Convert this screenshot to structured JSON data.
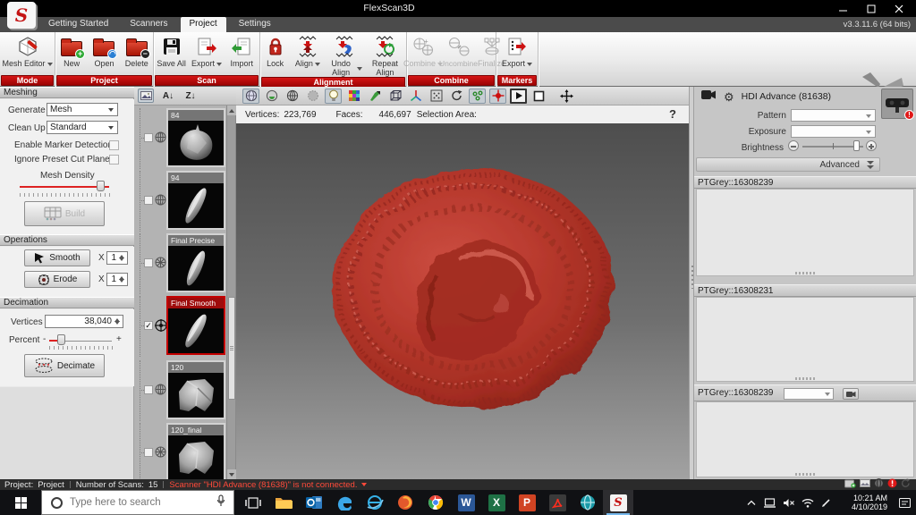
{
  "window": {
    "title": "FlexScan3D",
    "version": "v3.3.11.6  (64 bits)"
  },
  "tabs": [
    "Getting Started",
    "Scanners",
    "Project",
    "Settings"
  ],
  "ribbon": {
    "groups": [
      {
        "label": "Mode",
        "buttons": [
          {
            "label": "Mesh Editor"
          }
        ]
      },
      {
        "label": "Project",
        "buttons": [
          {
            "label": "New"
          },
          {
            "label": "Open"
          },
          {
            "label": "Delete"
          }
        ]
      },
      {
        "label": "Scan",
        "buttons": [
          {
            "label": "Save All"
          },
          {
            "label": "Export"
          },
          {
            "label": "Import"
          }
        ]
      },
      {
        "label": "Alignment",
        "buttons": [
          {
            "label": "Lock"
          },
          {
            "label": "Align"
          },
          {
            "label": "Undo Align"
          },
          {
            "label": "Repeat Align"
          }
        ]
      },
      {
        "label": "Combine",
        "buttons": [
          {
            "label": "Combine"
          },
          {
            "label": "Uncombine"
          },
          {
            "label": "Finalize"
          }
        ]
      },
      {
        "label": "Markers",
        "buttons": [
          {
            "label": "Export"
          }
        ]
      }
    ]
  },
  "meshing": {
    "title": "Meshing",
    "generate_label": "Generate",
    "generate_value": "Mesh",
    "cleanup_label": "Clean Up",
    "cleanup_value": "Standard",
    "marker_label": "Enable Marker Detection",
    "cutplanes_label": "Ignore Preset Cut Planes",
    "density_label": "Mesh Density",
    "build_label": "Build"
  },
  "operations": {
    "title": "Operations",
    "smooth_label": "Smooth",
    "erode_label": "Erode",
    "x_label": "X",
    "smooth_value": "1",
    "erode_value": "1"
  },
  "decimation": {
    "title": "Decimation",
    "vertices_label": "Vertices",
    "vertices_value": "38,040",
    "percent_label": "Percent",
    "minus": "-",
    "plus": "+",
    "decimate_label": "Decimate"
  },
  "scans": {
    "sort_az": "A↓",
    "sort_za": "Z↓",
    "items": [
      {
        "name": "84"
      },
      {
        "name": "94"
      },
      {
        "name": "Final Precise"
      },
      {
        "name": "Final Smooth",
        "selected": true
      },
      {
        "name": "120"
      },
      {
        "name": "120_final"
      }
    ]
  },
  "viewport": {
    "vertices_label": "Vertices:",
    "vertices_value": "223,769",
    "faces_label": "Faces:",
    "faces_value": "446,697",
    "selection_label": "Selection Area:",
    "help_label": "?"
  },
  "scanner_panel": {
    "title": "HDI Advance (81638)",
    "pattern_label": "Pattern",
    "exposure_label": "Exposure",
    "brightness_label": "Brightness",
    "advanced_label": "Advanced",
    "camera_a": "PTGrey::16308239",
    "camera_b": "PTGrey::16308231",
    "camera_c": "PTGrey::16308239"
  },
  "statusbar": {
    "project_label": "Project:",
    "project_value": "Project",
    "scans_label": "Number of Scans:",
    "scans_value": "15",
    "warning": "Scanner \"HDI Advance (81638)\" is not connected."
  },
  "taskbar": {
    "search_placeholder": "Type here to search",
    "time": "10:21 AM",
    "date": "4/10/2019"
  },
  "colors": {
    "accent_red": "#c00f0f",
    "selection_red": "#b00000",
    "warning_red": "#ff4a3a",
    "coin_red": "#b53328"
  }
}
